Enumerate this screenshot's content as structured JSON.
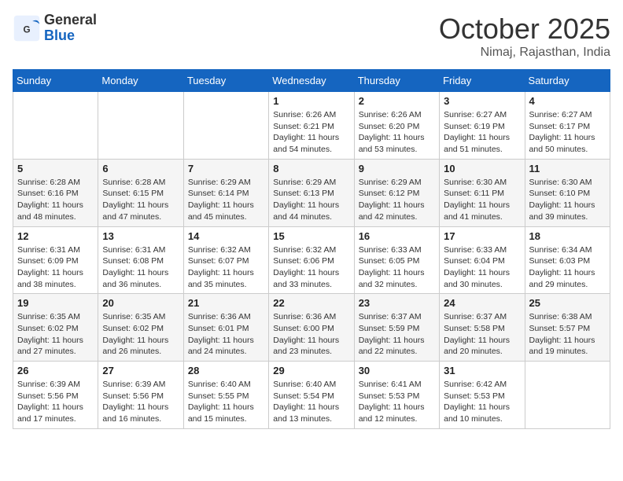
{
  "header": {
    "logo_general": "General",
    "logo_blue": "Blue",
    "month": "October 2025",
    "location": "Nimaj, Rajasthan, India"
  },
  "weekdays": [
    "Sunday",
    "Monday",
    "Tuesday",
    "Wednesday",
    "Thursday",
    "Friday",
    "Saturday"
  ],
  "weeks": [
    [
      {
        "day": "",
        "info": ""
      },
      {
        "day": "",
        "info": ""
      },
      {
        "day": "",
        "info": ""
      },
      {
        "day": "1",
        "info": "Sunrise: 6:26 AM\nSunset: 6:21 PM\nDaylight: 11 hours\nand 54 minutes."
      },
      {
        "day": "2",
        "info": "Sunrise: 6:26 AM\nSunset: 6:20 PM\nDaylight: 11 hours\nand 53 minutes."
      },
      {
        "day": "3",
        "info": "Sunrise: 6:27 AM\nSunset: 6:19 PM\nDaylight: 11 hours\nand 51 minutes."
      },
      {
        "day": "4",
        "info": "Sunrise: 6:27 AM\nSunset: 6:17 PM\nDaylight: 11 hours\nand 50 minutes."
      }
    ],
    [
      {
        "day": "5",
        "info": "Sunrise: 6:28 AM\nSunset: 6:16 PM\nDaylight: 11 hours\nand 48 minutes."
      },
      {
        "day": "6",
        "info": "Sunrise: 6:28 AM\nSunset: 6:15 PM\nDaylight: 11 hours\nand 47 minutes."
      },
      {
        "day": "7",
        "info": "Sunrise: 6:29 AM\nSunset: 6:14 PM\nDaylight: 11 hours\nand 45 minutes."
      },
      {
        "day": "8",
        "info": "Sunrise: 6:29 AM\nSunset: 6:13 PM\nDaylight: 11 hours\nand 44 minutes."
      },
      {
        "day": "9",
        "info": "Sunrise: 6:29 AM\nSunset: 6:12 PM\nDaylight: 11 hours\nand 42 minutes."
      },
      {
        "day": "10",
        "info": "Sunrise: 6:30 AM\nSunset: 6:11 PM\nDaylight: 11 hours\nand 41 minutes."
      },
      {
        "day": "11",
        "info": "Sunrise: 6:30 AM\nSunset: 6:10 PM\nDaylight: 11 hours\nand 39 minutes."
      }
    ],
    [
      {
        "day": "12",
        "info": "Sunrise: 6:31 AM\nSunset: 6:09 PM\nDaylight: 11 hours\nand 38 minutes."
      },
      {
        "day": "13",
        "info": "Sunrise: 6:31 AM\nSunset: 6:08 PM\nDaylight: 11 hours\nand 36 minutes."
      },
      {
        "day": "14",
        "info": "Sunrise: 6:32 AM\nSunset: 6:07 PM\nDaylight: 11 hours\nand 35 minutes."
      },
      {
        "day": "15",
        "info": "Sunrise: 6:32 AM\nSunset: 6:06 PM\nDaylight: 11 hours\nand 33 minutes."
      },
      {
        "day": "16",
        "info": "Sunrise: 6:33 AM\nSunset: 6:05 PM\nDaylight: 11 hours\nand 32 minutes."
      },
      {
        "day": "17",
        "info": "Sunrise: 6:33 AM\nSunset: 6:04 PM\nDaylight: 11 hours\nand 30 minutes."
      },
      {
        "day": "18",
        "info": "Sunrise: 6:34 AM\nSunset: 6:03 PM\nDaylight: 11 hours\nand 29 minutes."
      }
    ],
    [
      {
        "day": "19",
        "info": "Sunrise: 6:35 AM\nSunset: 6:02 PM\nDaylight: 11 hours\nand 27 minutes."
      },
      {
        "day": "20",
        "info": "Sunrise: 6:35 AM\nSunset: 6:02 PM\nDaylight: 11 hours\nand 26 minutes."
      },
      {
        "day": "21",
        "info": "Sunrise: 6:36 AM\nSunset: 6:01 PM\nDaylight: 11 hours\nand 24 minutes."
      },
      {
        "day": "22",
        "info": "Sunrise: 6:36 AM\nSunset: 6:00 PM\nDaylight: 11 hours\nand 23 minutes."
      },
      {
        "day": "23",
        "info": "Sunrise: 6:37 AM\nSunset: 5:59 PM\nDaylight: 11 hours\nand 22 minutes."
      },
      {
        "day": "24",
        "info": "Sunrise: 6:37 AM\nSunset: 5:58 PM\nDaylight: 11 hours\nand 20 minutes."
      },
      {
        "day": "25",
        "info": "Sunrise: 6:38 AM\nSunset: 5:57 PM\nDaylight: 11 hours\nand 19 minutes."
      }
    ],
    [
      {
        "day": "26",
        "info": "Sunrise: 6:39 AM\nSunset: 5:56 PM\nDaylight: 11 hours\nand 17 minutes."
      },
      {
        "day": "27",
        "info": "Sunrise: 6:39 AM\nSunset: 5:56 PM\nDaylight: 11 hours\nand 16 minutes."
      },
      {
        "day": "28",
        "info": "Sunrise: 6:40 AM\nSunset: 5:55 PM\nDaylight: 11 hours\nand 15 minutes."
      },
      {
        "day": "29",
        "info": "Sunrise: 6:40 AM\nSunset: 5:54 PM\nDaylight: 11 hours\nand 13 minutes."
      },
      {
        "day": "30",
        "info": "Sunrise: 6:41 AM\nSunset: 5:53 PM\nDaylight: 11 hours\nand 12 minutes."
      },
      {
        "day": "31",
        "info": "Sunrise: 6:42 AM\nSunset: 5:53 PM\nDaylight: 11 hours\nand 10 minutes."
      },
      {
        "day": "",
        "info": ""
      }
    ]
  ]
}
